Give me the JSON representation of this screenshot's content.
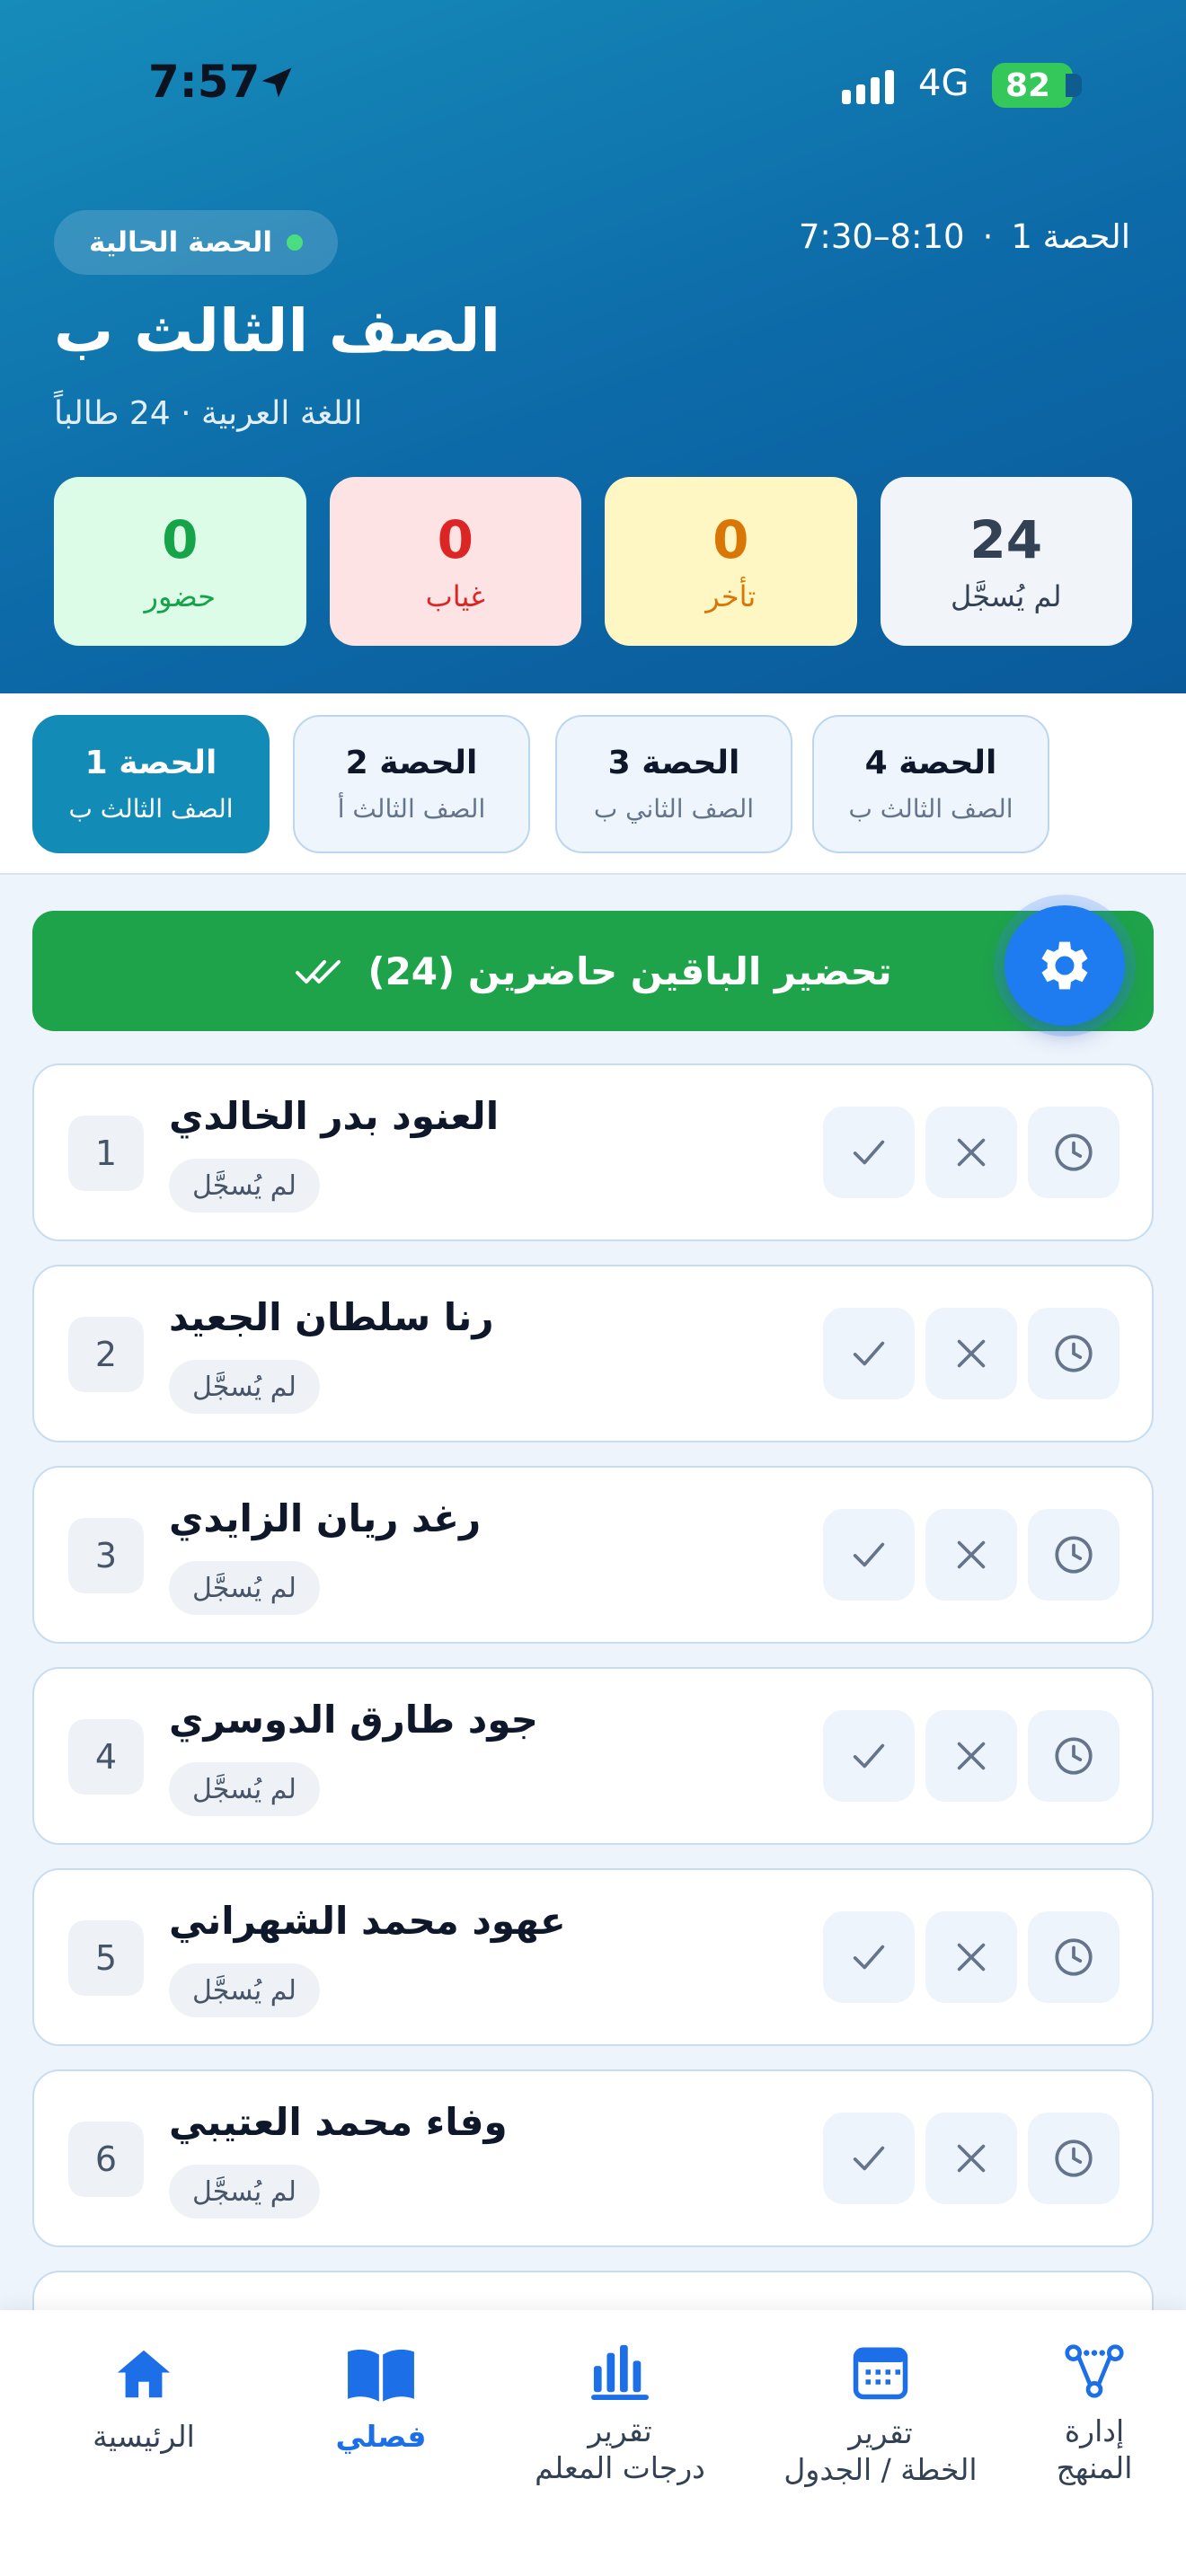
{
  "status_bar": {
    "time": "7:57",
    "network": "4G",
    "battery": "82"
  },
  "header": {
    "current_label": "الحصة الحالية",
    "period": "الحصة 1",
    "separator": "·",
    "time_range": "7:30–8:10",
    "class_name": "الصف الثالث ب",
    "subtitle": "اللغة العربية · 24 طالباً"
  },
  "stats": [
    {
      "value": "24",
      "label": "لم يُسجَّل",
      "bg": "#f1f4f8",
      "color": "#334155"
    },
    {
      "value": "0",
      "label": "تأخر",
      "bg": "#fef7c3",
      "color": "#d97706"
    },
    {
      "value": "0",
      "label": "غياب",
      "bg": "#fde3e3",
      "color": "#dc2626"
    },
    {
      "value": "0",
      "label": "حضور",
      "bg": "#dcfce7",
      "color": "#16a34a"
    }
  ],
  "tabs": [
    {
      "title": "الحصة 4",
      "subtitle": "الصف الثالث ب"
    },
    {
      "title": "الحصة 3",
      "subtitle": "الصف الثاني ب"
    },
    {
      "title": "الحصة 2",
      "subtitle": "الصف الثالث أ"
    },
    {
      "title": "الحصة 1",
      "subtitle": "الصف الثالث ب"
    }
  ],
  "mark_all": {
    "label": "تحضير الباقين حاضرين (24)"
  },
  "students": [
    {
      "index": "1",
      "name": "العنود بدر الخالدي",
      "status": "لم يُسجَّل"
    },
    {
      "index": "2",
      "name": "رنا سلطان الجعيد",
      "status": "لم يُسجَّل"
    },
    {
      "index": "3",
      "name": "رغد ريان الزايدي",
      "status": "لم يُسجَّل"
    },
    {
      "index": "4",
      "name": "جود طارق الدوسري",
      "status": "لم يُسجَّل"
    },
    {
      "index": "5",
      "name": "عهود محمد الشهراني",
      "status": "لم يُسجَّل"
    },
    {
      "index": "6",
      "name": "وفاء محمد العتيبي",
      "status": "لم يُسجَّل"
    }
  ],
  "nav": [
    {
      "label": "الرئيسية",
      "icon": "home-icon"
    },
    {
      "label": "فصلي",
      "icon": "book-icon"
    },
    {
      "label": "تقرير\nدرجات المعلم",
      "icon": "bar-chart-icon"
    },
    {
      "label": "تقرير\nالخطة / الجدول",
      "icon": "calendar-icon"
    },
    {
      "label": "إدارة\nالمنهج",
      "icon": "hierarchy-icon"
    }
  ],
  "colors": {
    "accent": "#128bb7",
    "success": "#1fa34a",
    "primary": "#1d6fe8"
  }
}
